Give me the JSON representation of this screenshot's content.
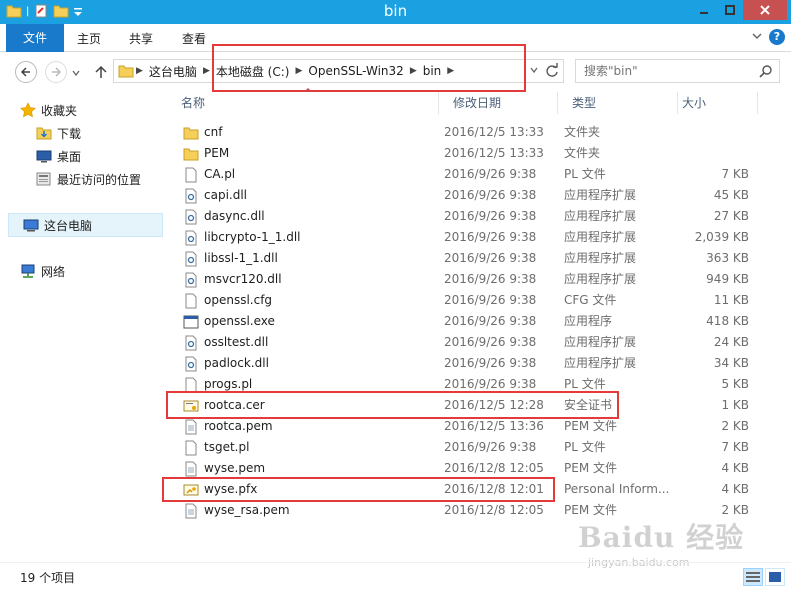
{
  "window": {
    "title": "bin"
  },
  "ribbon": {
    "tabs": [
      "文件",
      "主页",
      "共享",
      "查看"
    ]
  },
  "address": {
    "crumbs": [
      "这台电脑",
      "本地磁盘 (C:)",
      "OpenSSL-Win32",
      "bin"
    ]
  },
  "search": {
    "placeholder": "搜索\"bin\""
  },
  "sidebar": {
    "favorites": {
      "label": "收藏夹",
      "items": [
        "下载",
        "桌面",
        "最近访问的位置"
      ]
    },
    "this_pc": "这台电脑",
    "network": "网络"
  },
  "columns": {
    "name": "名称",
    "date": "修改日期",
    "type": "类型",
    "size": "大小"
  },
  "files": [
    {
      "name": "cnf",
      "date": "2016/12/5 13:33",
      "type": "文件夹",
      "size": "",
      "icon": "folder-icon"
    },
    {
      "name": "PEM",
      "date": "2016/12/5 13:33",
      "type": "文件夹",
      "size": "",
      "icon": "folder-icon"
    },
    {
      "name": "CA.pl",
      "date": "2016/9/26 9:38",
      "type": "PL 文件",
      "size": "7 KB",
      "icon": "file-icon"
    },
    {
      "name": "capi.dll",
      "date": "2016/9/26 9:38",
      "type": "应用程序扩展",
      "size": "45 KB",
      "icon": "dll-icon"
    },
    {
      "name": "dasync.dll",
      "date": "2016/9/26 9:38",
      "type": "应用程序扩展",
      "size": "27 KB",
      "icon": "dll-icon"
    },
    {
      "name": "libcrypto-1_1.dll",
      "date": "2016/9/26 9:38",
      "type": "应用程序扩展",
      "size": "2,039 KB",
      "icon": "dll-icon"
    },
    {
      "name": "libssl-1_1.dll",
      "date": "2016/9/26 9:38",
      "type": "应用程序扩展",
      "size": "363 KB",
      "icon": "dll-icon"
    },
    {
      "name": "msvcr120.dll",
      "date": "2016/9/26 9:38",
      "type": "应用程序扩展",
      "size": "949 KB",
      "icon": "dll-icon"
    },
    {
      "name": "openssl.cfg",
      "date": "2016/9/26 9:38",
      "type": "CFG 文件",
      "size": "11 KB",
      "icon": "file-icon"
    },
    {
      "name": "openssl.exe",
      "date": "2016/9/26 9:38",
      "type": "应用程序",
      "size": "418 KB",
      "icon": "exe-icon"
    },
    {
      "name": "ossltest.dll",
      "date": "2016/9/26 9:38",
      "type": "应用程序扩展",
      "size": "24 KB",
      "icon": "dll-icon"
    },
    {
      "name": "padlock.dll",
      "date": "2016/9/26 9:38",
      "type": "应用程序扩展",
      "size": "34 KB",
      "icon": "dll-icon"
    },
    {
      "name": "progs.pl",
      "date": "2016/9/26 9:38",
      "type": "PL 文件",
      "size": "5 KB",
      "icon": "file-icon"
    },
    {
      "name": "rootca.cer",
      "date": "2016/12/5 12:28",
      "type": "安全证书",
      "size": "1 KB",
      "icon": "certificate-icon"
    },
    {
      "name": "rootca.pem",
      "date": "2016/12/5 13:36",
      "type": "PEM 文件",
      "size": "2 KB",
      "icon": "text-file-icon"
    },
    {
      "name": "tsget.pl",
      "date": "2016/9/26 9:38",
      "type": "PL 文件",
      "size": "7 KB",
      "icon": "file-icon"
    },
    {
      "name": "wyse.pem",
      "date": "2016/12/8 12:05",
      "type": "PEM 文件",
      "size": "4 KB",
      "icon": "text-file-icon"
    },
    {
      "name": "wyse.pfx",
      "date": "2016/12/8 12:01",
      "type": "Personal Inform...",
      "size": "4 KB",
      "icon": "pfx-icon"
    },
    {
      "name": "wyse_rsa.pem",
      "date": "2016/12/8 12:05",
      "type": "PEM 文件",
      "size": "2 KB",
      "icon": "text-file-icon"
    }
  ],
  "status": {
    "count": "19 个项目"
  },
  "watermark": {
    "main": "Baidu 经验",
    "sub": "jingyan.baidu.com"
  },
  "colors": {
    "titlebar": "#1ba1e2",
    "file_tab": "#1979ca",
    "annotation": "#e53a3a"
  }
}
